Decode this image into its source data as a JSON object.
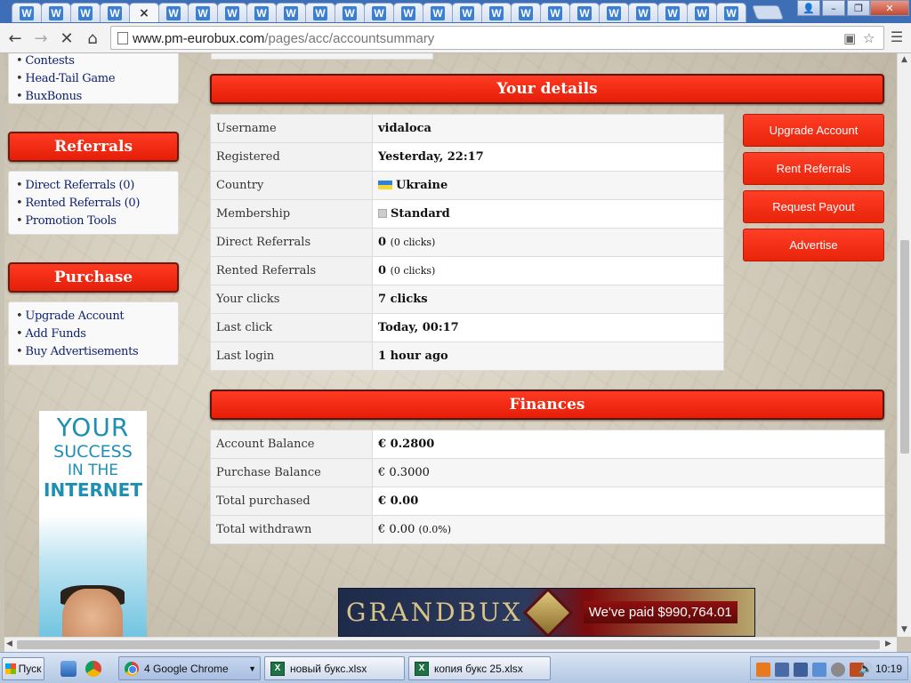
{
  "browser": {
    "tab_icon_letter": "W",
    "active_tab_close": "×",
    "url_host": "www.pm-eurobux.com",
    "url_path": "/pages/acc/accountsummary",
    "window_controls": {
      "user": "👤",
      "minimize": "–",
      "maximize": "❐",
      "close": "✕"
    }
  },
  "sidebar": {
    "top_links": [
      "Contests",
      "Head-Tail Game",
      "BuxBonus"
    ],
    "referrals": {
      "title": "Referrals",
      "links": [
        "Direct Referrals (0)",
        "Rented Referrals (0)",
        "Promotion Tools"
      ]
    },
    "purchase": {
      "title": "Purchase",
      "links": [
        "Upgrade Account",
        "Add Funds",
        "Buy Advertisements"
      ]
    },
    "banner": {
      "line1": "YOUR",
      "line2": "SUCCESS",
      "line3": "IN THE",
      "line4": "INTERNET"
    }
  },
  "details": {
    "title": "Your details",
    "rows": [
      {
        "label": "Username",
        "value": "vidaloca"
      },
      {
        "label": "Registered",
        "value": "Yesterday, 22:17"
      },
      {
        "label": "Country",
        "value": "Ukraine"
      },
      {
        "label": "Membership",
        "value": "Standard"
      },
      {
        "label": "Direct Referrals",
        "value": "0",
        "note": "(0 clicks)"
      },
      {
        "label": "Rented Referrals",
        "value": "0",
        "note": "(0 clicks)"
      },
      {
        "label": "Your clicks",
        "value": "7 clicks"
      },
      {
        "label": "Last click",
        "value": "Today, 00:17"
      },
      {
        "label": "Last login",
        "value": "1 hour ago"
      }
    ]
  },
  "actions": [
    "Upgrade Account",
    "Rent Referrals",
    "Request Payout",
    "Advertise"
  ],
  "finances": {
    "title": "Finances",
    "rows": [
      {
        "label": "Account Balance",
        "value": "€ 0.2800"
      },
      {
        "label": "Purchase Balance",
        "value": "€ 0.3000"
      },
      {
        "label": "Total purchased",
        "value": "€ 0.00"
      },
      {
        "label": "Total withdrawn",
        "value": "€ 0.00",
        "note": "(0.0%)"
      }
    ]
  },
  "ad": {
    "brand": "GRANDBUX",
    "paid_text": "We've paid $990,764.01"
  },
  "taskbar": {
    "start_label": "Пуск",
    "items": [
      "4 Google Chrome",
      "новый букс.xlsx",
      "копия букс 25.xlsx"
    ],
    "clock": "10:19"
  },
  "colors": {
    "header_red": "#e41e08",
    "link_navy": "#0b1f6e"
  }
}
